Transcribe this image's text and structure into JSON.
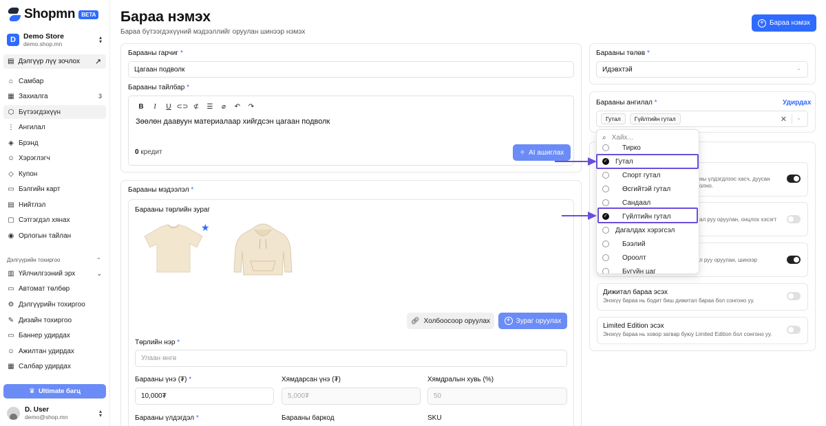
{
  "brand": {
    "name": "Shopmn",
    "badge": "BETA"
  },
  "store": {
    "initial": "D",
    "name": "Demo Store",
    "url": "demo.shop.mn"
  },
  "visit_store": "Дэлгүүр лүү зочлох",
  "nav": [
    {
      "label": "Самбар",
      "icon": "home-icon"
    },
    {
      "label": "Захиалга",
      "icon": "orders-icon",
      "count": "3"
    },
    {
      "label": "Бүтээгдэхүүн",
      "icon": "product-icon",
      "active": true
    },
    {
      "label": "Ангилал",
      "icon": "category-icon"
    },
    {
      "label": "Брэнд",
      "icon": "brand-icon"
    },
    {
      "label": "Хэрэглэгч",
      "icon": "users-icon"
    },
    {
      "label": "Купон",
      "icon": "coupon-icon"
    },
    {
      "label": "Бэлгийн карт",
      "icon": "gift-card-icon"
    },
    {
      "label": "Нийтлэл",
      "icon": "article-icon"
    },
    {
      "label": "Сэтгэгдэл хянах",
      "icon": "review-icon"
    },
    {
      "label": "Орлогын тайлан",
      "icon": "report-icon"
    }
  ],
  "settings_section": "Дэлгүүрийн тохиргоо",
  "settings_nav": [
    {
      "label": "Үйлчилгээний эрх",
      "icon": "permission-icon",
      "chevron": true
    },
    {
      "label": "Автомат төлбөр",
      "icon": "payment-icon"
    },
    {
      "label": "Дэлгүүрийн тохиргоо",
      "icon": "settings-icon"
    },
    {
      "label": "Дизайн тохиргоо",
      "icon": "design-icon"
    },
    {
      "label": "Баннер удирдах",
      "icon": "banner-icon"
    },
    {
      "label": "Ажилтан удирдах",
      "icon": "staff-icon"
    },
    {
      "label": "Салбар удирдах",
      "icon": "branch-icon"
    }
  ],
  "ultimate": "Ultimate багц",
  "user": {
    "name": "D. User",
    "email": "demo@shop.mn"
  },
  "header": {
    "title": "Бараа нэмэх",
    "subtitle": "Бараа бүтээгдэхүүний мэдээллийг оруулан шинээр нэмэх",
    "add_button": "Бараа нэмэх"
  },
  "form": {
    "title_label": "Барааны гарчиг",
    "title_value": "Цагаан подволк",
    "desc_label": "Барааны тайлбар",
    "desc_value": "Зөөлөн даавуун материалаар хийгдсэн цагаан подволк",
    "credit_count": "0",
    "credit_label": "кредит",
    "ai_button": "AI ашиглах",
    "info_label": "Барааны мэдээлэл",
    "variant_image_label": "Барааны төрлийн зураг",
    "link_upload": "Холбоосоор оруулах",
    "image_upload": "Зураг оруулах",
    "variant_name_label": "Төрлийн нэр",
    "variant_name_placeholder": "Улаан өнгө",
    "price_label": "Барааны үнэ (₮)",
    "price_value": "10,000₮",
    "discount_price_label": "Хямдарсан үнэ (₮)",
    "discount_price_placeholder": "5,000₮",
    "discount_percent_label": "Хямдралын хувь (%)",
    "discount_percent_placeholder": "50",
    "stock_label": "Барааны үлдэгдэл",
    "barcode_label": "Барааны баркод",
    "sku_label": "SKU"
  },
  "right": {
    "status_label": "Барааны төлөв",
    "status_value": "Идэвхтэй",
    "category_label": "Барааны ангилал",
    "manage": "Удирдах",
    "selected_tags": [
      "Гутал",
      "Гүйлтийн гутал"
    ],
    "opt1_desc_a": "ны үлдэгдлээс хасч, дуусан",
    "opt1_desc_b": "олно.",
    "opt2_desc": "ал руу оруулан, онцлох хэсэгт",
    "opt3_desc": "л руу оруулан, шинээр",
    "digital_title": "Дижитал бараа эсэх",
    "digital_desc": "Энэхүү бараа нь бодит биш дижитал бараа бол сонгоно уу.",
    "limited_title": "Limited Edition эсэх",
    "limited_desc": "Энэхүү бараа нь ховор загвар буюу Limited Edition бол сонгоно уу."
  },
  "dropdown": {
    "search_placeholder": "Хайх...",
    "items": [
      {
        "label": "Тирко",
        "checked": false,
        "indent": true
      },
      {
        "label": "Гутал",
        "checked": true,
        "indent": false
      },
      {
        "label": "Спорт гутал",
        "checked": false,
        "indent": true
      },
      {
        "label": "Өсгийтэй гутал",
        "checked": false,
        "indent": true
      },
      {
        "label": "Сандаал",
        "checked": false,
        "indent": true
      },
      {
        "label": "Гүйлтийн гутал",
        "checked": true,
        "indent": true
      },
      {
        "label": "Дагалдах хэрэгсэл",
        "checked": false,
        "indent": false
      },
      {
        "label": "Бээлий",
        "checked": false,
        "indent": true
      },
      {
        "label": "Ороолт",
        "checked": false,
        "indent": true
      },
      {
        "label": "Бугуйн цаг",
        "checked": false,
        "indent": true
      }
    ]
  },
  "colors": {
    "accent": "#2f6bff",
    "accent_light": "#6b8cf6",
    "highlight": "#6a4ddb"
  }
}
